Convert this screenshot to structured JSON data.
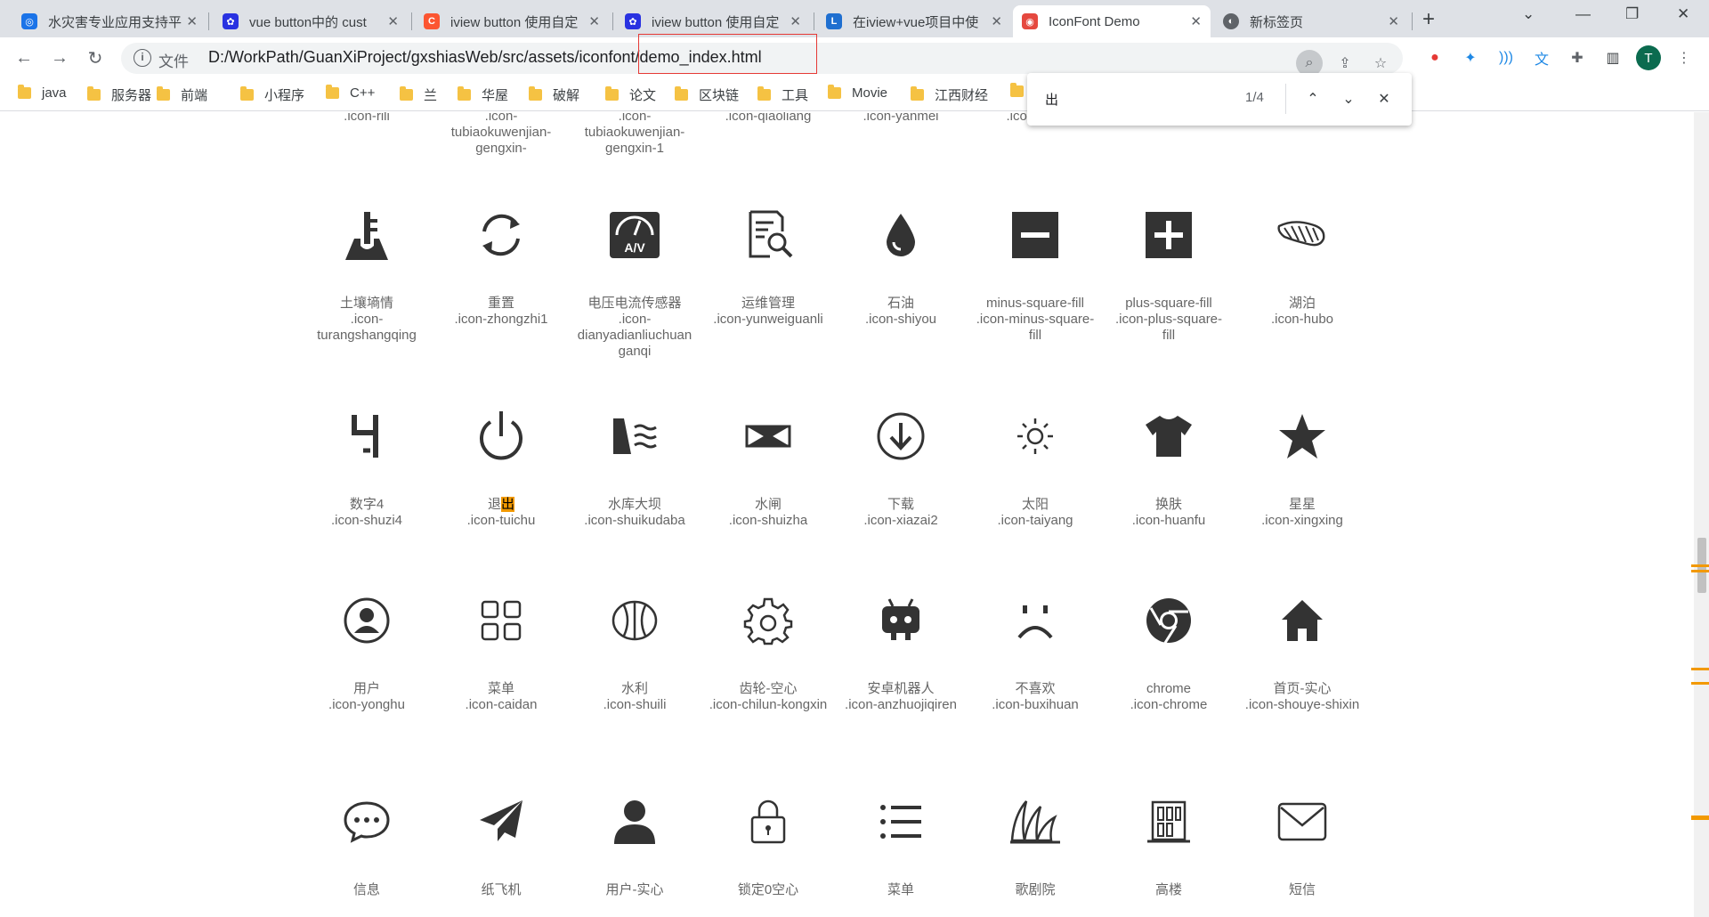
{
  "tabs": [
    {
      "label": "水灾害专业应用支持平",
      "icon": "hydro-icon",
      "color": "#1a73e8"
    },
    {
      "label": "vue button中的 cust",
      "icon": "baidu-paw-icon",
      "color": "#2932e1"
    },
    {
      "label": "iview button 使用自定",
      "icon": "csdn-icon",
      "color": "#fc5531"
    },
    {
      "label": "iview button 使用自定",
      "icon": "baidu-paw-icon",
      "color": "#2932e1"
    },
    {
      "label": "在iview+vue项目中使",
      "icon": "log-icon",
      "color": "#1f6fd0"
    },
    {
      "label": "IconFont Demo",
      "icon": "iconfont-icon",
      "color": "#e5483f"
    },
    {
      "label": "新标签页",
      "icon": "globe-icon",
      "color": "#5f6368"
    }
  ],
  "toolbar": {
    "file_label": "文件",
    "url": "D:/WorkPath/GuanXiProject/gxshiasWeb/src/assets/iconfont/demo_index.html",
    "profile_initial": "T"
  },
  "bookmarks": [
    "java",
    "服务器",
    "前端",
    "小程序",
    "C++",
    "兰",
    "华屋",
    "破解",
    "论文",
    "区块链",
    "工具",
    "Movie",
    "江西财经"
  ],
  "find": {
    "query": "出",
    "count": "1/4"
  },
  "top_row": [
    {
      "code": ".icon-rili"
    },
    {
      "code": ".icon-tubiaokuwenjian-gengxin-"
    },
    {
      "code": ".icon-tubiaokuwenjian-gengxin-1"
    },
    {
      "code": ".icon-qiaoliang"
    },
    {
      "code": ".icon-yanmei"
    },
    {
      "code": ".icon-e"
    }
  ],
  "icons": [
    {
      "name": "土壤墒情",
      "code": ".icon-turangshangqing",
      "glyph": "soil-moisture-icon"
    },
    {
      "name": "重置",
      "code": ".icon-zhongzhi1",
      "glyph": "reset-icon"
    },
    {
      "name": "电压电流传感器",
      "code": ".icon-dianyadianliuchuanganqi",
      "glyph": "voltmeter-icon"
    },
    {
      "name": "运维管理",
      "code": ".icon-yunweiguanli",
      "glyph": "maintenance-icon"
    },
    {
      "name": "石油",
      "code": ".icon-shiyou",
      "glyph": "oil-drop-icon"
    },
    {
      "name": "minus-square-fill",
      "code": ".icon-minus-square-fill",
      "glyph": "minus-square-icon"
    },
    {
      "name": "plus-square-fill",
      "code": ".icon-plus-square-fill",
      "glyph": "plus-square-icon"
    },
    {
      "name": "湖泊",
      "code": ".icon-hubo",
      "glyph": "lake-icon"
    },
    {
      "name": "数字4",
      "code": ".icon-shuzi4",
      "glyph": "digit-four-icon"
    },
    {
      "name": "退出",
      "code": ".icon-tuichu",
      "glyph": "power-icon"
    },
    {
      "name": "水库大坝",
      "code": ".icon-shuikudaba",
      "glyph": "dam-icon"
    },
    {
      "name": "水闸",
      "code": ".icon-shuizha",
      "glyph": "sluice-gate-icon"
    },
    {
      "name": "下载",
      "code": ".icon-xiazai2",
      "glyph": "download-icon"
    },
    {
      "name": "太阳",
      "code": ".icon-taiyang",
      "glyph": "sun-icon"
    },
    {
      "name": "换肤",
      "code": ".icon-huanfu",
      "glyph": "tshirt-icon"
    },
    {
      "name": "星星",
      "code": ".icon-xingxing",
      "glyph": "star-icon"
    },
    {
      "name": "用户",
      "code": ".icon-yonghu",
      "glyph": "user-circle-icon"
    },
    {
      "name": "菜单",
      "code": ".icon-caidan",
      "glyph": "grid-menu-icon"
    },
    {
      "name": "水利",
      "code": ".icon-shuili",
      "glyph": "water-conservancy-icon"
    },
    {
      "name": "齿轮-空心",
      "code": ".icon-chilun-kongxin",
      "glyph": "gear-outline-icon"
    },
    {
      "name": "安卓机器人",
      "code": ".icon-anzhuojiqiren",
      "glyph": "robot-icon"
    },
    {
      "name": "不喜欢",
      "code": ".icon-buxihuan",
      "glyph": "sad-face-icon"
    },
    {
      "name": "chrome",
      "code": ".icon-chrome",
      "glyph": "chrome-icon"
    },
    {
      "name": "首页-实心",
      "code": ".icon-shouye-shixin",
      "glyph": "home-icon"
    },
    {
      "name": "信息",
      "code": "",
      "glyph": "chat-bubble-icon"
    },
    {
      "name": "纸飞机",
      "code": "",
      "glyph": "paper-plane-icon"
    },
    {
      "name": "用户-实心",
      "code": "",
      "glyph": "user-solid-icon"
    },
    {
      "name": "锁定0空心",
      "code": "",
      "glyph": "lock-outline-icon"
    },
    {
      "name": "菜单",
      "code": "",
      "glyph": "list-menu-icon"
    },
    {
      "name": "歌剧院",
      "code": "",
      "glyph": "opera-house-icon"
    },
    {
      "name": "高楼",
      "code": "",
      "glyph": "building-icon"
    },
    {
      "name": "短信",
      "code": "",
      "glyph": "envelope-icon"
    }
  ]
}
